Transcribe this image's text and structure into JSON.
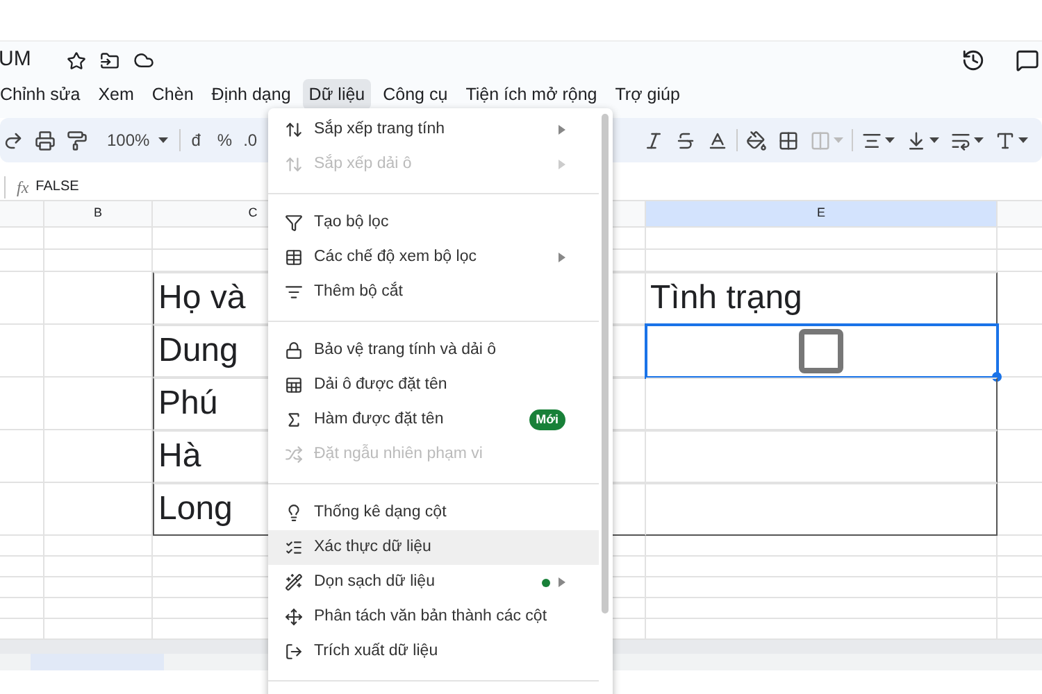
{
  "document": {
    "title": "UM"
  },
  "menu_bar": [
    {
      "label": "Chỉnh sửa",
      "selected": false
    },
    {
      "label": "Xem",
      "selected": false
    },
    {
      "label": "Chèn",
      "selected": false
    },
    {
      "label": "Định dạng",
      "selected": false
    },
    {
      "label": "Dữ liệu",
      "selected": true
    },
    {
      "label": "Công cụ",
      "selected": false
    },
    {
      "label": "Tiện ích mở rộng",
      "selected": false
    },
    {
      "label": "Trợ giúp",
      "selected": false
    }
  ],
  "toolbar": {
    "zoom": "100%",
    "currency": "đ",
    "percent": "%",
    "decimal": ".0"
  },
  "formula_bar": {
    "label": "fx",
    "value": "FALSE"
  },
  "columns": [
    {
      "label": "B",
      "selected": false
    },
    {
      "label": "C",
      "selected": false
    },
    {
      "label": "E",
      "selected": true
    }
  ],
  "table": {
    "rows": [
      {
        "name": "Họ và",
        "status": {
          "kind": "text",
          "text": "Tình trạng"
        },
        "selected": false
      },
      {
        "name": "Dung",
        "status": {
          "kind": "checkbox",
          "checked": false
        },
        "selected": true
      },
      {
        "name": "Phú",
        "selected": false
      },
      {
        "name": "Hà",
        "selected": false
      },
      {
        "name": "Long",
        "selected": false
      }
    ]
  },
  "data_menu": {
    "items": [
      {
        "kind": "item",
        "label": "Sắp xếp trang tính",
        "disabled": false,
        "submenu": true,
        "selected": false
      },
      {
        "kind": "item",
        "label": "Sắp xếp dải ô",
        "disabled": true,
        "submenu": true,
        "selected": false
      },
      {
        "kind": "divider"
      },
      {
        "kind": "item",
        "label": "Tạo bộ lọc",
        "disabled": false,
        "submenu": false,
        "selected": false
      },
      {
        "kind": "item",
        "label": "Các chế độ xem bộ lọc",
        "disabled": false,
        "submenu": true,
        "selected": false
      },
      {
        "kind": "item",
        "label": "Thêm bộ cắt",
        "disabled": false,
        "submenu": false,
        "selected": false
      },
      {
        "kind": "divider"
      },
      {
        "kind": "item",
        "label": "Bảo vệ trang tính và dải ô",
        "disabled": false,
        "submenu": false,
        "selected": false
      },
      {
        "kind": "item",
        "label": "Dải ô được đặt tên",
        "disabled": false,
        "submenu": false,
        "selected": false
      },
      {
        "kind": "item",
        "label": "Hàm được đặt tên",
        "disabled": false,
        "submenu": false,
        "selected": false,
        "badge": "Mới"
      },
      {
        "kind": "item",
        "label": "Đặt ngẫu nhiên phạm vi",
        "disabled": true,
        "submenu": false,
        "selected": false
      },
      {
        "kind": "divider"
      },
      {
        "kind": "item",
        "label": "Thống kê dạng cột",
        "disabled": false,
        "submenu": false,
        "selected": false
      },
      {
        "kind": "item",
        "label": "Xác thực dữ liệu",
        "disabled": false,
        "submenu": false,
        "selected": true
      },
      {
        "kind": "item",
        "label": "Dọn sạch dữ liệu",
        "disabled": false,
        "submenu": true,
        "selected": false,
        "dot": true
      },
      {
        "kind": "item",
        "label": "Phân tách văn bản thành các cột",
        "disabled": false,
        "submenu": false,
        "selected": false
      },
      {
        "kind": "item",
        "label": "Trích xuất dữ liệu",
        "disabled": false,
        "submenu": false,
        "selected": false
      },
      {
        "kind": "divider"
      }
    ]
  }
}
